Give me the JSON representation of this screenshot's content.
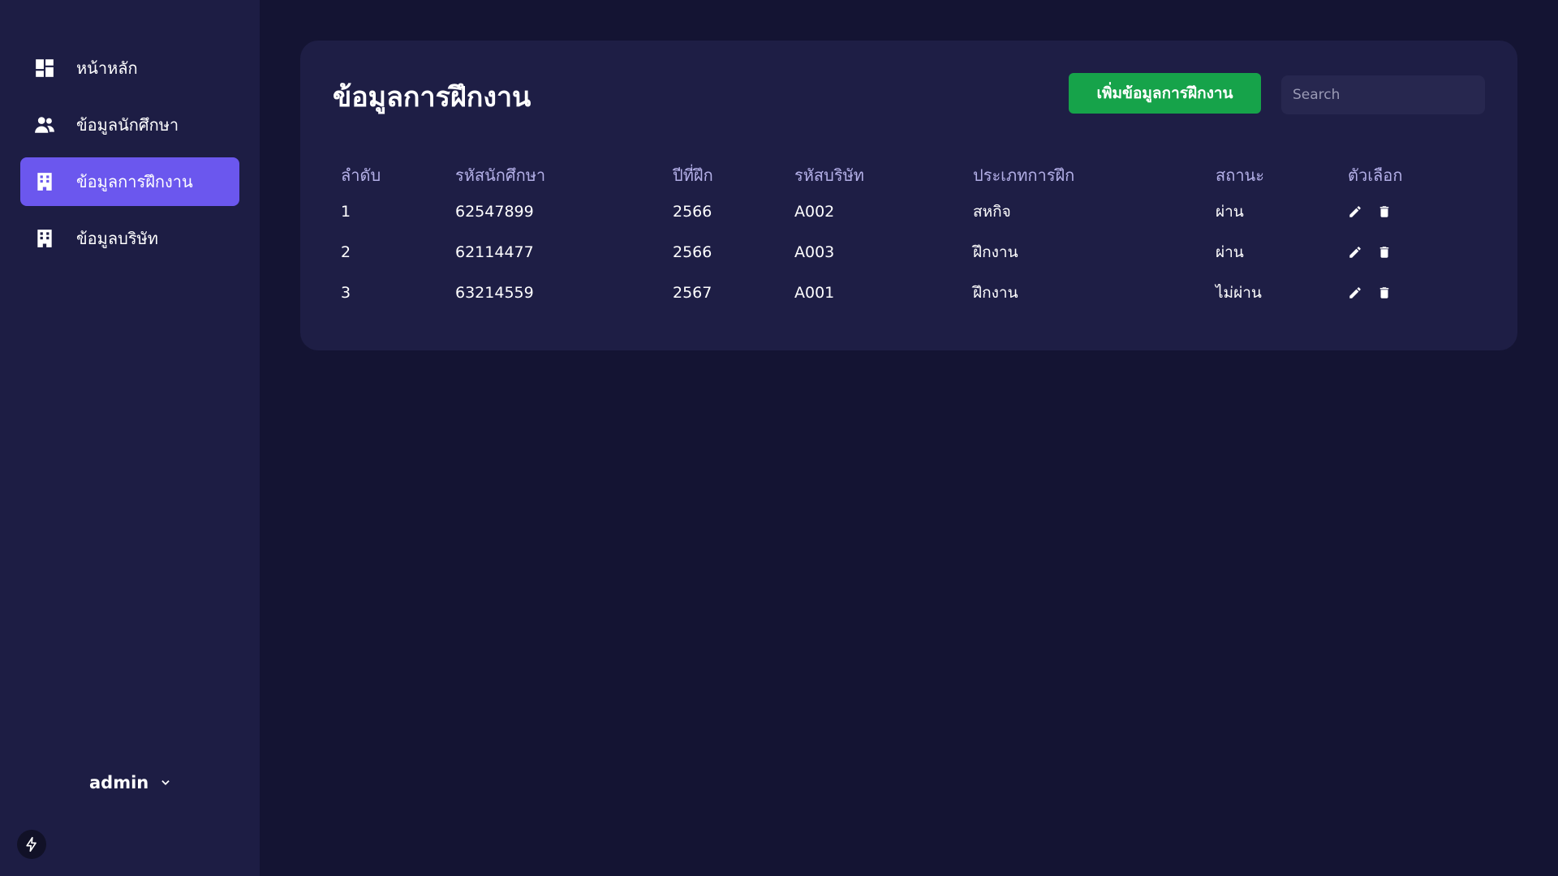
{
  "sidebar": {
    "items": [
      {
        "label": "หน้าหลัก",
        "icon": "dashboard-icon",
        "active": false
      },
      {
        "label": "ข้อมูลนักศึกษา",
        "icon": "users-icon",
        "active": false
      },
      {
        "label": "ข้อมูลการฝึกงาน",
        "icon": "building-icon",
        "active": true
      },
      {
        "label": "ข้อมูลบริษัท",
        "icon": "building-icon",
        "active": false
      }
    ],
    "user": {
      "name": "admin"
    }
  },
  "main": {
    "title": "ข้อมูลการฝึกงาน",
    "add_button": "เพิ่มข้อมูลการฝึกงาน",
    "search": {
      "placeholder": "Search",
      "value": ""
    },
    "table": {
      "headers": [
        "ลำดับ",
        "รหัสนักศึกษา",
        "ปีที่ฝึก",
        "รหัสบริษัท",
        "ประเภทการฝึก",
        "สถานะ",
        "ตัวเลือก"
      ],
      "rows": [
        {
          "no": "1",
          "student_id": "62547899",
          "year": "2566",
          "company_id": "A002",
          "type": "สหกิจ",
          "status": "ผ่าน"
        },
        {
          "no": "2",
          "student_id": "62114477",
          "year": "2566",
          "company_id": "A003",
          "type": "ฝึกงาน",
          "status": "ผ่าน"
        },
        {
          "no": "3",
          "student_id": "63214559",
          "year": "2567",
          "company_id": "A001",
          "type": "ฝึกงาน",
          "status": "ไม่ผ่าน"
        }
      ]
    }
  },
  "colors": {
    "background": "#141433",
    "sidebar": "#1d1d44",
    "card": "#1e1e45",
    "active_nav": "#6b57ee",
    "add_button": "#16a34a",
    "header_text": "#b4b0e8"
  }
}
